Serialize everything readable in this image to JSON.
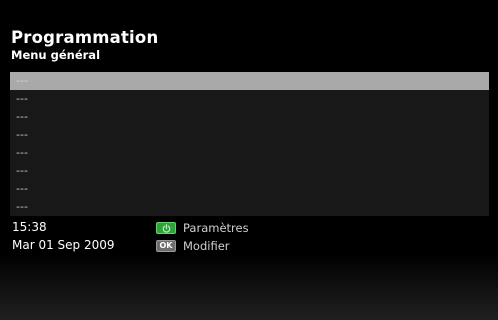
{
  "header": {
    "title": "Programmation",
    "subtitle": "Menu général"
  },
  "list": {
    "items": [
      "---",
      "---",
      "---",
      "---",
      "---",
      "---",
      "---",
      "---"
    ],
    "selected_index": 0
  },
  "status": {
    "time": "15:38",
    "date": "Mar 01 Sep 2009"
  },
  "legend": {
    "green_key_icon": "power-icon",
    "green_key_color": "#2fa33a",
    "green_label": "Paramètres",
    "ok_key_text": "OK",
    "ok_label": "Modifier"
  }
}
